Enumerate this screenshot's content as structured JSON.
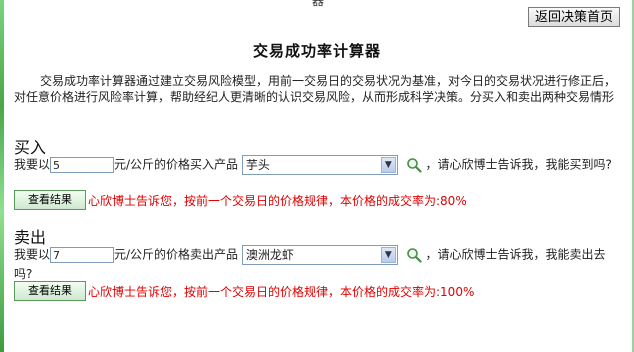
{
  "top_glyph": "器",
  "back_button": "返回决策首页",
  "title": "交易成功率计算器",
  "intro": "交易成功率计算器通过建立交易风险模型，用前一交易日的交易状况为基准，对今日的交易状况进行修正后，对任意价格进行风险率计算，帮助经纪人更清晰的认识交易风险，从而形成科学决策。分买入和卖出两种交易情形",
  "buy": {
    "heading": "买入",
    "prefix": "我要以",
    "quantity": "5",
    "unit_text": "元/公斤的价格买入产品",
    "product": "芋头",
    "suffix": "，请心欣博士告诉我，我能买到吗?",
    "button": "查看结果",
    "result": "心欣博士告诉您，按前一个交易日的价格规律，本价格的成交率为:80%"
  },
  "sell": {
    "heading": "卖出",
    "prefix": "我要以",
    "quantity": "7",
    "unit_text": "元/公斤的价格卖出产品",
    "product": "澳洲龙虾",
    "suffix": "，请心欣博士告诉我，我能卖出去吗?",
    "button": "查看结果",
    "result": "心欣博士告诉您，按前一个交易日的价格规律，本价格的成交率为:100%"
  },
  "colors": {
    "result_text": "#e00000",
    "edge_green": "#4aa64a"
  },
  "icons": {
    "select_arrow": "chevron-down-icon",
    "search": "search-icon"
  }
}
